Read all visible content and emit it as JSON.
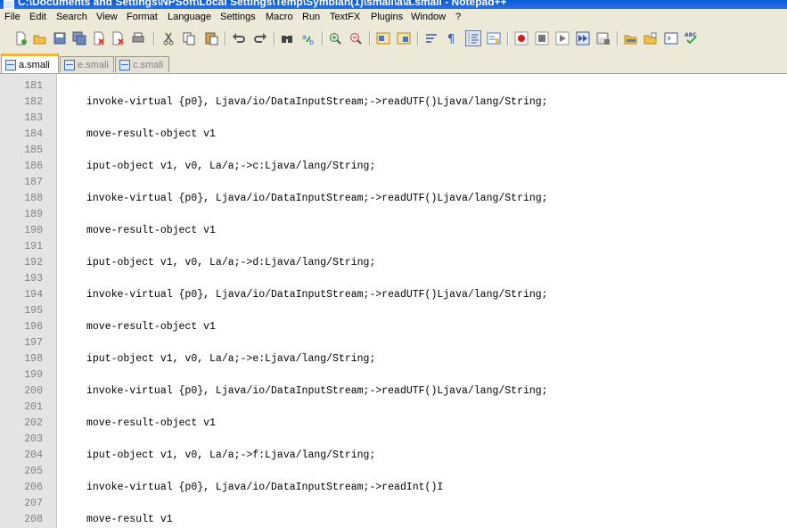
{
  "window": {
    "title": "C:\\Documents and Settings\\NPSoft\\Local Settings\\Temp\\Symbian(1)\\smali\\a\\a.smali - Notepad++"
  },
  "menu": [
    "File",
    "Edit",
    "Search",
    "View",
    "Format",
    "Language",
    "Settings",
    "Macro",
    "Run",
    "TextFX",
    "Plugins",
    "Window",
    "?"
  ],
  "tabs": [
    {
      "label": "a.smali",
      "active": true
    },
    {
      "label": "e.smali",
      "active": false
    },
    {
      "label": "c.smali",
      "active": false
    }
  ],
  "lines": [
    {
      "n": "181",
      "code": ""
    },
    {
      "n": "182",
      "code": "invoke-virtual {p0}, Ljava/io/DataInputStream;->readUTF()Ljava/lang/String;"
    },
    {
      "n": "183",
      "code": ""
    },
    {
      "n": "184",
      "code": "move-result-object v1"
    },
    {
      "n": "185",
      "code": ""
    },
    {
      "n": "186",
      "code": "iput-object v1, v0, La/a;->c:Ljava/lang/String;"
    },
    {
      "n": "187",
      "code": ""
    },
    {
      "n": "188",
      "code": "invoke-virtual {p0}, Ljava/io/DataInputStream;->readUTF()Ljava/lang/String;"
    },
    {
      "n": "189",
      "code": ""
    },
    {
      "n": "190",
      "code": "move-result-object v1"
    },
    {
      "n": "191",
      "code": ""
    },
    {
      "n": "192",
      "code": "iput-object v1, v0, La/a;->d:Ljava/lang/String;"
    },
    {
      "n": "193",
      "code": ""
    },
    {
      "n": "194",
      "code": "invoke-virtual {p0}, Ljava/io/DataInputStream;->readUTF()Ljava/lang/String;"
    },
    {
      "n": "195",
      "code": ""
    },
    {
      "n": "196",
      "code": "move-result-object v1"
    },
    {
      "n": "197",
      "code": ""
    },
    {
      "n": "198",
      "code": "iput-object v1, v0, La/a;->e:Ljava/lang/String;"
    },
    {
      "n": "199",
      "code": ""
    },
    {
      "n": "200",
      "code": "invoke-virtual {p0}, Ljava/io/DataInputStream;->readUTF()Ljava/lang/String;"
    },
    {
      "n": "201",
      "code": ""
    },
    {
      "n": "202",
      "code": "move-result-object v1"
    },
    {
      "n": "203",
      "code": ""
    },
    {
      "n": "204",
      "code": "iput-object v1, v0, La/a;->f:Ljava/lang/String;"
    },
    {
      "n": "205",
      "code": ""
    },
    {
      "n": "206",
      "code": "invoke-virtual {p0}, Ljava/io/DataInputStream;->readInt()I"
    },
    {
      "n": "207",
      "code": ""
    },
    {
      "n": "208",
      "code": "move-result v1"
    }
  ]
}
